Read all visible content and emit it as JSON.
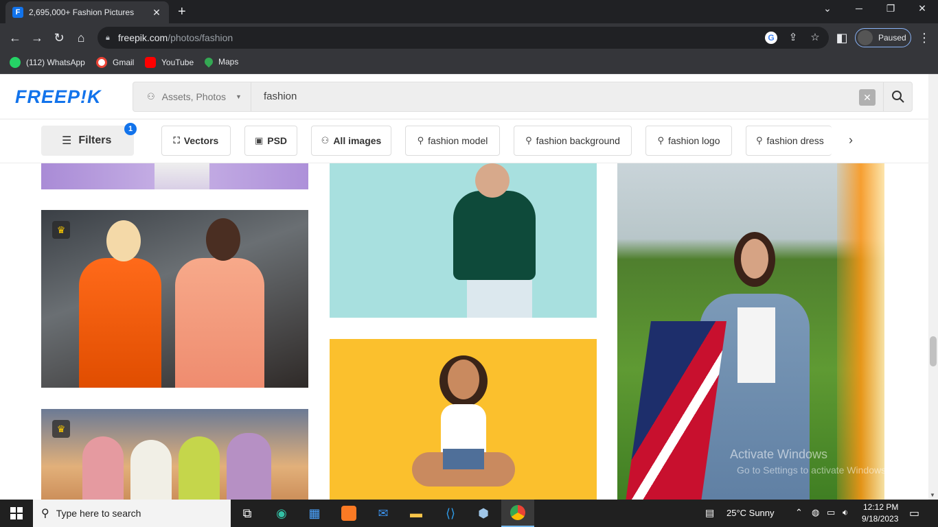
{
  "browser": {
    "tab_title": "2,695,000+ Fashion Pictures",
    "url_host": "freepik.com",
    "url_path": "/photos/fashion",
    "profile_label": "Paused",
    "bookmarks": [
      {
        "label": "(112) WhatsApp",
        "icon": "whatsapp-icon",
        "color": "#25d366"
      },
      {
        "label": "Gmail",
        "icon": "google-icon",
        "color": "#ffffff"
      },
      {
        "label": "YouTube",
        "icon": "youtube-icon",
        "color": "#ff0000"
      },
      {
        "label": "Maps",
        "icon": "maps-pin-icon",
        "color": "#34a853"
      }
    ]
  },
  "site": {
    "logo": "FREEP!K",
    "brand_color": "#1273eb",
    "search": {
      "asset_type": "Assets, Photos",
      "query": "fashion"
    },
    "filters": {
      "label": "Filters",
      "badge_count": "1"
    },
    "chips": [
      {
        "label": "Vectors",
        "icon": "vector-icon",
        "bold": true
      },
      {
        "label": "PSD",
        "icon": "psd-icon",
        "bold": true
      },
      {
        "label": "All images",
        "icon": "images-icon",
        "bold": true
      },
      {
        "label": "fashion model",
        "icon": "search-icon",
        "bold": false
      },
      {
        "label": "fashion background",
        "icon": "search-icon",
        "bold": false
      },
      {
        "label": "fashion logo",
        "icon": "search-icon",
        "bold": false
      },
      {
        "label": "fashion dress",
        "icon": "search-icon",
        "bold": false
      }
    ]
  },
  "overlay": {
    "line1": "Activate Windows",
    "line2": "Go to Settings to activate Windows."
  },
  "taskbar": {
    "search_placeholder": "Type here to search",
    "weather": "25°C  Sunny",
    "time": "12:12 PM",
    "date": "9/18/2023"
  }
}
